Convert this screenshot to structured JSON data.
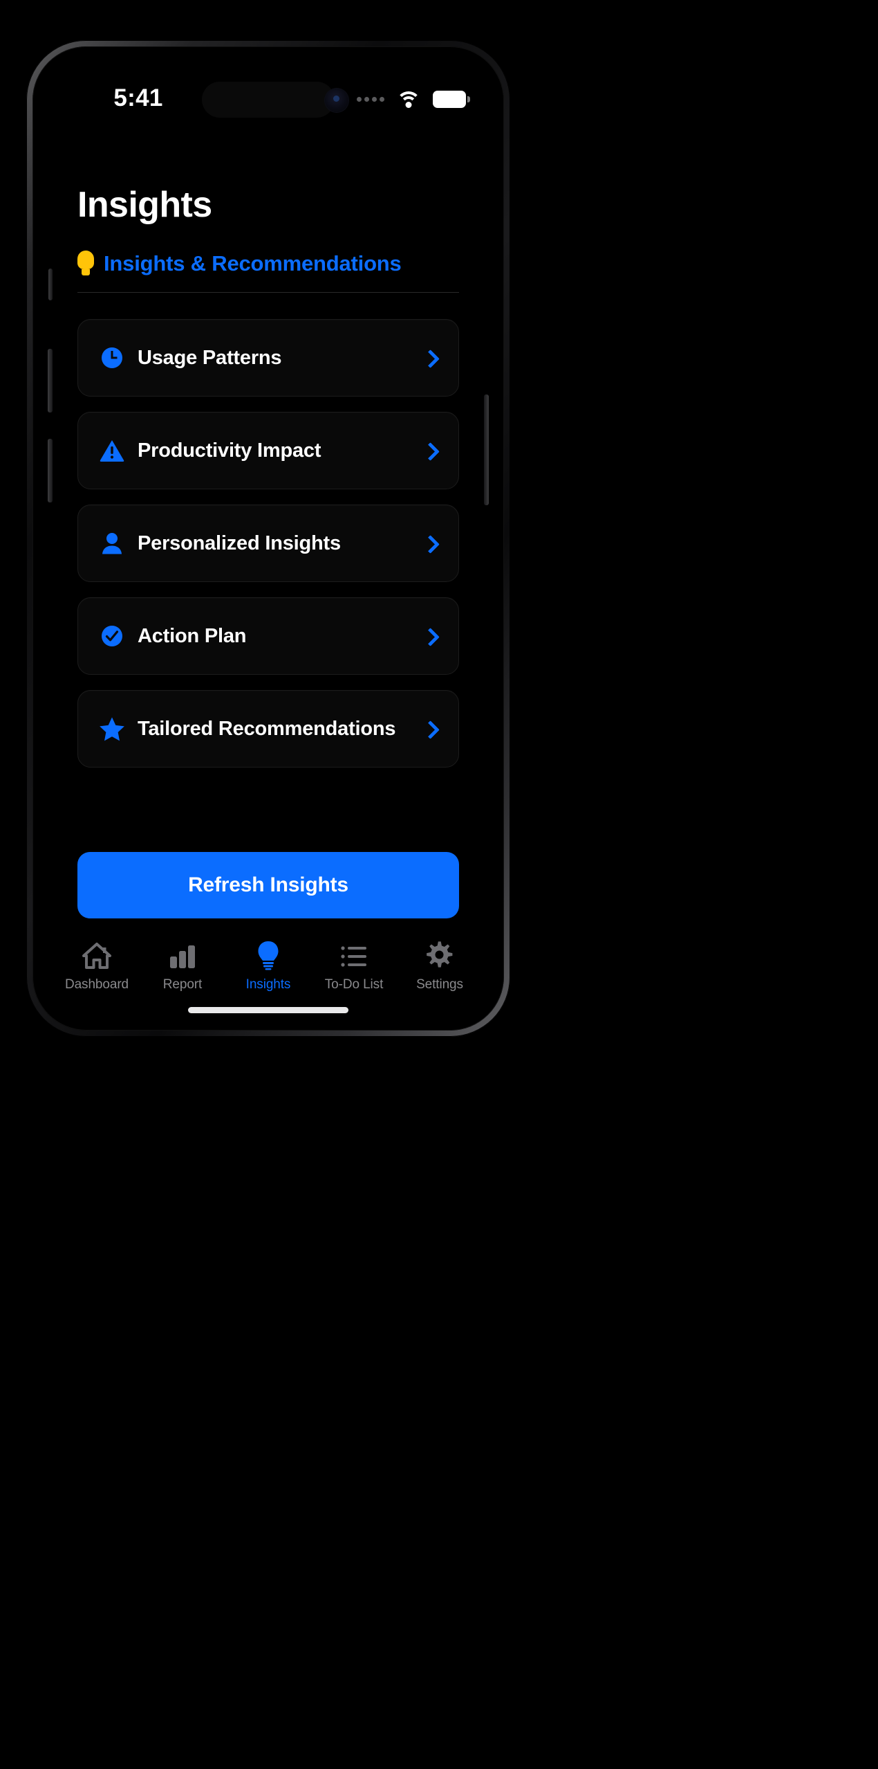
{
  "status_bar": {
    "time": "5:41",
    "signal_icon": "signal-dots-icon",
    "wifi_icon": "wifi-icon",
    "battery_icon": "battery-icon"
  },
  "header": {
    "page_title": "Insights"
  },
  "section": {
    "icon": "lightbulb-icon",
    "title": "Insights & Recommendations"
  },
  "cards": [
    {
      "label": "Usage Patterns",
      "icon": "clock-icon",
      "chevron": "chevron-right-icon"
    },
    {
      "label": "Productivity Impact",
      "icon": "warning-icon",
      "chevron": "chevron-right-icon"
    },
    {
      "label": "Personalized Insights",
      "icon": "person-icon",
      "chevron": "chevron-right-icon"
    },
    {
      "label": "Action Plan",
      "icon": "check-circle-icon",
      "chevron": "chevron-right-icon"
    },
    {
      "label": "Tailored Recommendations",
      "icon": "star-icon",
      "chevron": "chevron-right-icon"
    }
  ],
  "cta": {
    "label": "Refresh Insights"
  },
  "tabbar": {
    "items": [
      {
        "label": "Dashboard",
        "icon": "home-icon",
        "active": false
      },
      {
        "label": "Report",
        "icon": "bar-chart-icon",
        "active": false
      },
      {
        "label": "Insights",
        "icon": "lightbulb-icon",
        "active": true
      },
      {
        "label": "To-Do List",
        "icon": "list-icon",
        "active": false
      },
      {
        "label": "Settings",
        "icon": "gear-icon",
        "active": false
      }
    ]
  },
  "colors": {
    "accent": "#0B6DFF",
    "bulb": "#FFC409",
    "card_bg": "#090909",
    "inactive_tab": "#8a8a8d",
    "screen_bg": "#000000"
  }
}
